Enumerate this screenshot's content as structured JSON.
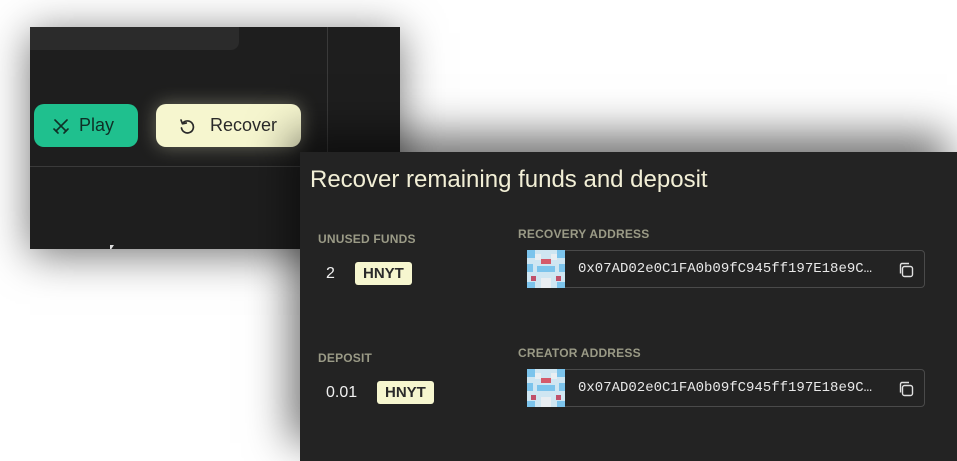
{
  "back": {
    "play_label": "Play",
    "recover_label": "Recover"
  },
  "modal": {
    "title": "Recover remaining funds and deposit",
    "unused_funds": {
      "label": "UNUSED FUNDS",
      "amount": "2",
      "token": "HNYT"
    },
    "deposit": {
      "label": "DEPOSIT",
      "amount": "0.01",
      "token": "HNYT"
    },
    "recovery_address": {
      "label": "RECOVERY ADDRESS",
      "value": "0x07AD02e0C1FA0b09fC945ff197E18e9C…"
    },
    "creator_address": {
      "label": "CREATOR ADDRESS",
      "value": "0x07AD02e0C1FA0b09fC945ff197E18e9C…"
    }
  },
  "colors": {
    "play_button": "#1fc08e",
    "recover_button": "#f6f6cf",
    "modal_background": "#232323",
    "badge": "#f6f6cf"
  },
  "icons": [
    "swords-icon",
    "undo-icon",
    "copy-icon",
    "identicon-avatar"
  ]
}
